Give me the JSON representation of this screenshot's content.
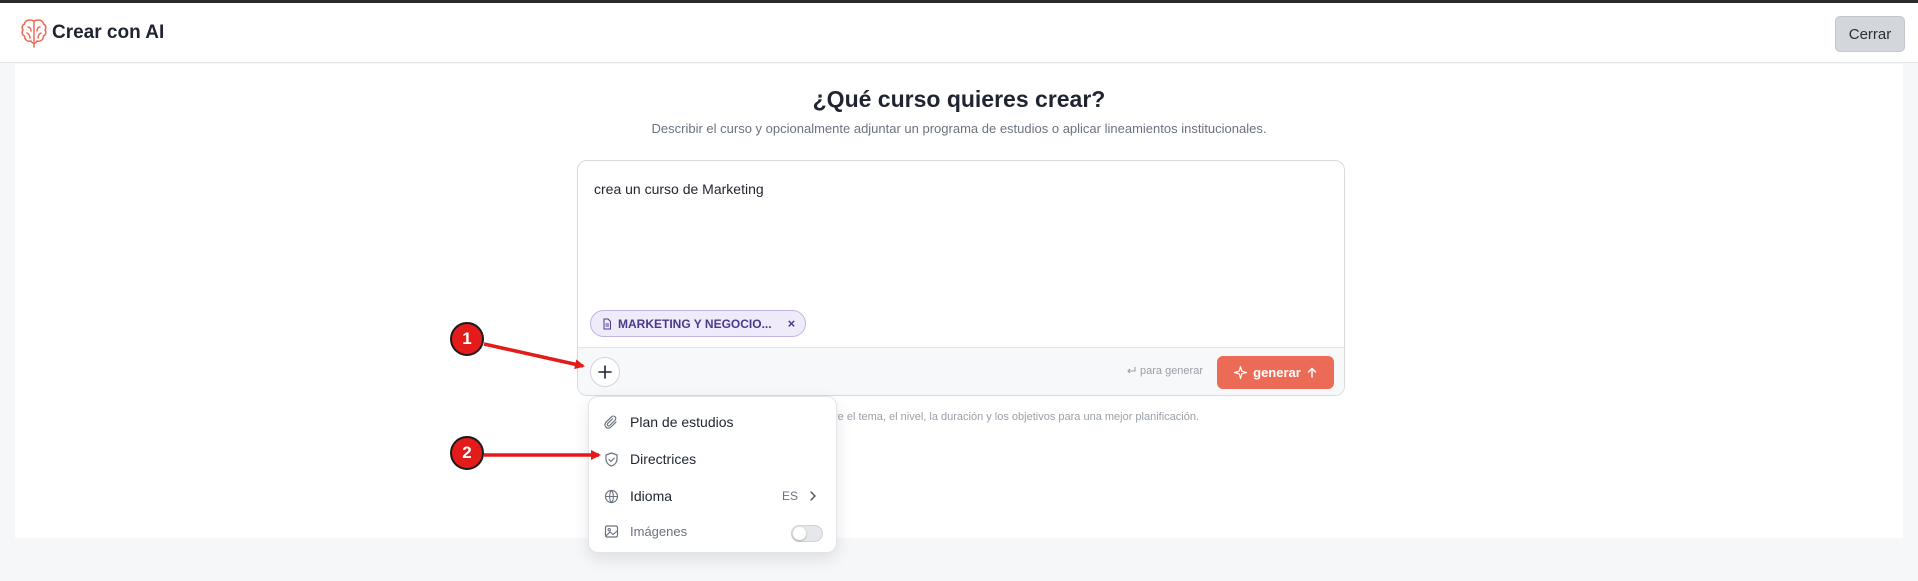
{
  "header": {
    "app_title": "Crear con AI",
    "close_label": "Cerrar",
    "logo_icon": "brain-icon",
    "logo_color": "#ec6b57"
  },
  "main": {
    "title": "¿Qué curso quieres crear?",
    "subtitle": "Describir el curso y opcionalmente adjuntar un programa de estudios o aplicar lineamientos institucionales."
  },
  "composer": {
    "prompt_value": "crea un curso de Marketing",
    "attachment_label": "MARKETING Y NEGOCIO...",
    "attachment_remove": "×",
    "hint_label": "para generar",
    "generate_label": "generar",
    "accent_color": "#ec6b57"
  },
  "help_text": "re el tema, el nivel, la duración y los objetivos para una mejor planificación.",
  "menu": {
    "items": [
      {
        "label": "Plan de estudios",
        "icon": "paperclip-icon"
      },
      {
        "label": "Directrices",
        "icon": "shield-icon"
      },
      {
        "label": "Idioma",
        "icon": "globe-icon",
        "value": "ES"
      },
      {
        "label": "Imágenes",
        "icon": "image-icon",
        "toggle": false
      }
    ]
  },
  "annotations": {
    "badge_1": "1",
    "badge_2": "2",
    "arrow_color": "#e31b1b"
  }
}
